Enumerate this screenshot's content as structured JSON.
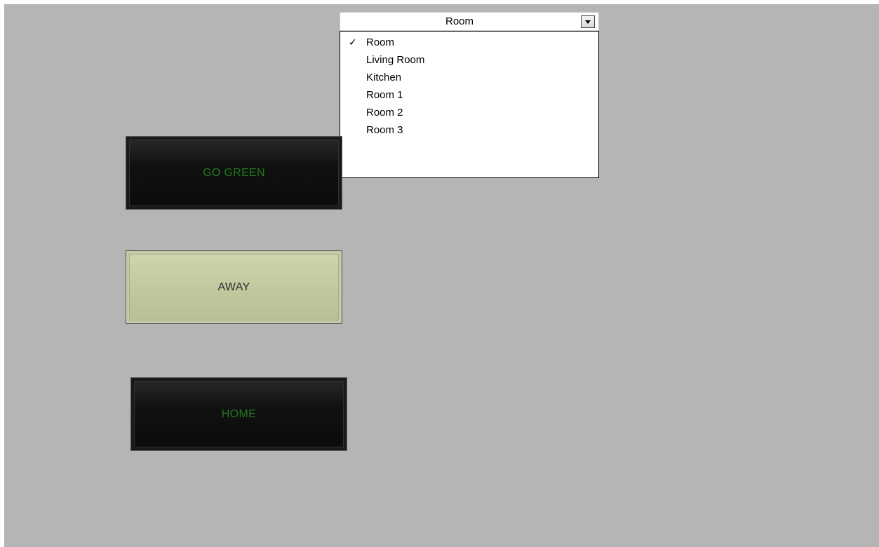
{
  "ring": {
    "selected": "Room",
    "options": [
      {
        "label": "Room",
        "checked": true
      },
      {
        "label": "Living Room",
        "checked": false
      },
      {
        "label": "Kitchen",
        "checked": false
      },
      {
        "label": "Room 1",
        "checked": false
      },
      {
        "label": "Room 2",
        "checked": false
      },
      {
        "label": "Room 3",
        "checked": false
      }
    ],
    "check_glyph": "✓"
  },
  "buttons": {
    "go_green": {
      "label": "GO GREEN",
      "text_color": "#1f7a1f",
      "state": "off"
    },
    "away": {
      "label": "AWAY",
      "text_color": "#2a2a2a",
      "state": "on"
    },
    "home": {
      "label": "HOME",
      "text_color": "#1f7a1f",
      "state": "off"
    }
  },
  "colors": {
    "panel_background": "#b5b5b5",
    "button_dark": "#111111",
    "button_light": "#c2c99f"
  }
}
